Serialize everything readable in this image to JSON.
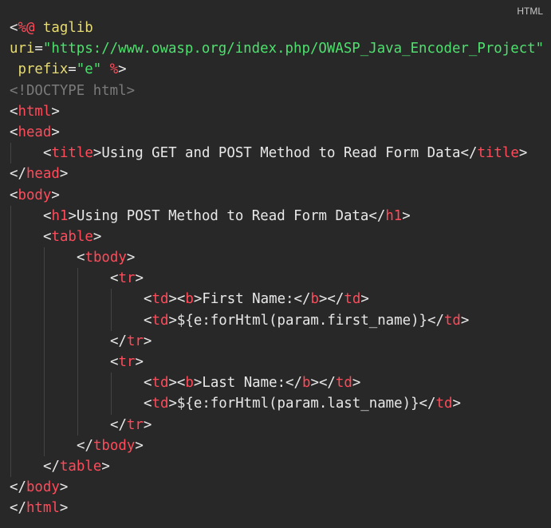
{
  "language_label": "HTML",
  "colors": {
    "background": "#282828",
    "text": "#e8e8e8",
    "tag": "#ff4b5a",
    "attribute": "#e6db74",
    "string": "#4ee06e",
    "doctype": "#7a7a7a"
  },
  "lines": [
    {
      "indent": 0,
      "tokens": [
        {
          "c": "t",
          "v": "<"
        },
        {
          "c": "pct",
          "v": "%@"
        },
        {
          "c": "attr",
          "v": " taglib"
        }
      ]
    },
    {
      "indent": 0,
      "tokens": [
        {
          "c": "attr",
          "v": "uri"
        },
        {
          "c": "t",
          "v": "="
        },
        {
          "c": "str",
          "v": "\"https://www.owasp.org/index.php/OWASP_Java_Encoder_Project\""
        }
      ]
    },
    {
      "indent": 0,
      "tokens": [
        {
          "c": "attr",
          "v": " prefix"
        },
        {
          "c": "t",
          "v": "="
        },
        {
          "c": "str",
          "v": "\"e\""
        },
        {
          "c": "t",
          "v": " "
        },
        {
          "c": "pct",
          "v": "%"
        },
        {
          "c": "t",
          "v": ">"
        }
      ]
    },
    {
      "indent": 0,
      "tokens": [
        {
          "c": "cmt",
          "v": "<!DOCTYPE html>"
        }
      ]
    },
    {
      "indent": 0,
      "tokens": [
        {
          "c": "t",
          "v": "<"
        },
        {
          "c": "tag",
          "v": "html"
        },
        {
          "c": "t",
          "v": ">"
        }
      ]
    },
    {
      "indent": 0,
      "tokens": [
        {
          "c": "t",
          "v": "<"
        },
        {
          "c": "tag",
          "v": "head"
        },
        {
          "c": "t",
          "v": ">"
        }
      ]
    },
    {
      "indent": 1,
      "tokens": [
        {
          "c": "t",
          "v": "<"
        },
        {
          "c": "tag",
          "v": "title"
        },
        {
          "c": "t",
          "v": ">Using GET and POST Method to Read Form Data</"
        },
        {
          "c": "tag",
          "v": "title"
        },
        {
          "c": "t",
          "v": ">"
        }
      ]
    },
    {
      "indent": 0,
      "tokens": [
        {
          "c": "t",
          "v": "</"
        },
        {
          "c": "tag",
          "v": "head"
        },
        {
          "c": "t",
          "v": ">"
        }
      ]
    },
    {
      "indent": 0,
      "tokens": [
        {
          "c": "t",
          "v": "<"
        },
        {
          "c": "tag",
          "v": "body"
        },
        {
          "c": "t",
          "v": ">"
        }
      ]
    },
    {
      "indent": 1,
      "tokens": [
        {
          "c": "t",
          "v": "<"
        },
        {
          "c": "tag",
          "v": "h1"
        },
        {
          "c": "t",
          "v": ">Using POST Method to Read Form Data</"
        },
        {
          "c": "tag",
          "v": "h1"
        },
        {
          "c": "t",
          "v": ">"
        }
      ]
    },
    {
      "indent": 1,
      "tokens": [
        {
          "c": "t",
          "v": "<"
        },
        {
          "c": "tag",
          "v": "table"
        },
        {
          "c": "t",
          "v": ">"
        }
      ]
    },
    {
      "indent": 2,
      "tokens": [
        {
          "c": "t",
          "v": "<"
        },
        {
          "c": "tag",
          "v": "tbody"
        },
        {
          "c": "t",
          "v": ">"
        }
      ]
    },
    {
      "indent": 3,
      "tokens": [
        {
          "c": "t",
          "v": "<"
        },
        {
          "c": "tag",
          "v": "tr"
        },
        {
          "c": "t",
          "v": ">"
        }
      ]
    },
    {
      "indent": 4,
      "tokens": [
        {
          "c": "t",
          "v": "<"
        },
        {
          "c": "tag",
          "v": "td"
        },
        {
          "c": "t",
          "v": "><"
        },
        {
          "c": "tag",
          "v": "b"
        },
        {
          "c": "t",
          "v": ">First Name:</"
        },
        {
          "c": "tag",
          "v": "b"
        },
        {
          "c": "t",
          "v": "></"
        },
        {
          "c": "tag",
          "v": "td"
        },
        {
          "c": "t",
          "v": ">"
        }
      ]
    },
    {
      "indent": 4,
      "tokens": [
        {
          "c": "t",
          "v": "<"
        },
        {
          "c": "tag",
          "v": "td"
        },
        {
          "c": "t",
          "v": ">${e:forHtml(param.first_name)}</"
        },
        {
          "c": "tag",
          "v": "td"
        },
        {
          "c": "t",
          "v": ">"
        }
      ]
    },
    {
      "indent": 3,
      "tokens": [
        {
          "c": "t",
          "v": "</"
        },
        {
          "c": "tag",
          "v": "tr"
        },
        {
          "c": "t",
          "v": ">"
        }
      ]
    },
    {
      "indent": 3,
      "tokens": [
        {
          "c": "t",
          "v": "<"
        },
        {
          "c": "tag",
          "v": "tr"
        },
        {
          "c": "t",
          "v": ">"
        }
      ]
    },
    {
      "indent": 4,
      "tokens": [
        {
          "c": "t",
          "v": "<"
        },
        {
          "c": "tag",
          "v": "td"
        },
        {
          "c": "t",
          "v": "><"
        },
        {
          "c": "tag",
          "v": "b"
        },
        {
          "c": "t",
          "v": ">Last Name:</"
        },
        {
          "c": "tag",
          "v": "b"
        },
        {
          "c": "t",
          "v": "></"
        },
        {
          "c": "tag",
          "v": "td"
        },
        {
          "c": "t",
          "v": ">"
        }
      ]
    },
    {
      "indent": 4,
      "tokens": [
        {
          "c": "t",
          "v": "<"
        },
        {
          "c": "tag",
          "v": "td"
        },
        {
          "c": "t",
          "v": ">${e:forHtml(param.last_name)}</"
        },
        {
          "c": "tag",
          "v": "td"
        },
        {
          "c": "t",
          "v": ">"
        }
      ]
    },
    {
      "indent": 3,
      "tokens": [
        {
          "c": "t",
          "v": "</"
        },
        {
          "c": "tag",
          "v": "tr"
        },
        {
          "c": "t",
          "v": ">"
        }
      ]
    },
    {
      "indent": 2,
      "tokens": [
        {
          "c": "t",
          "v": "</"
        },
        {
          "c": "tag",
          "v": "tbody"
        },
        {
          "c": "t",
          "v": ">"
        }
      ]
    },
    {
      "indent": 1,
      "tokens": [
        {
          "c": "t",
          "v": "</"
        },
        {
          "c": "tag",
          "v": "table"
        },
        {
          "c": "t",
          "v": ">"
        }
      ]
    },
    {
      "indent": 0,
      "tokens": [
        {
          "c": "t",
          "v": "</"
        },
        {
          "c": "tag",
          "v": "body"
        },
        {
          "c": "t",
          "v": ">"
        }
      ]
    },
    {
      "indent": 0,
      "tokens": [
        {
          "c": "t",
          "v": "</"
        },
        {
          "c": "tag",
          "v": "html"
        },
        {
          "c": "t",
          "v": ">"
        }
      ]
    }
  ]
}
